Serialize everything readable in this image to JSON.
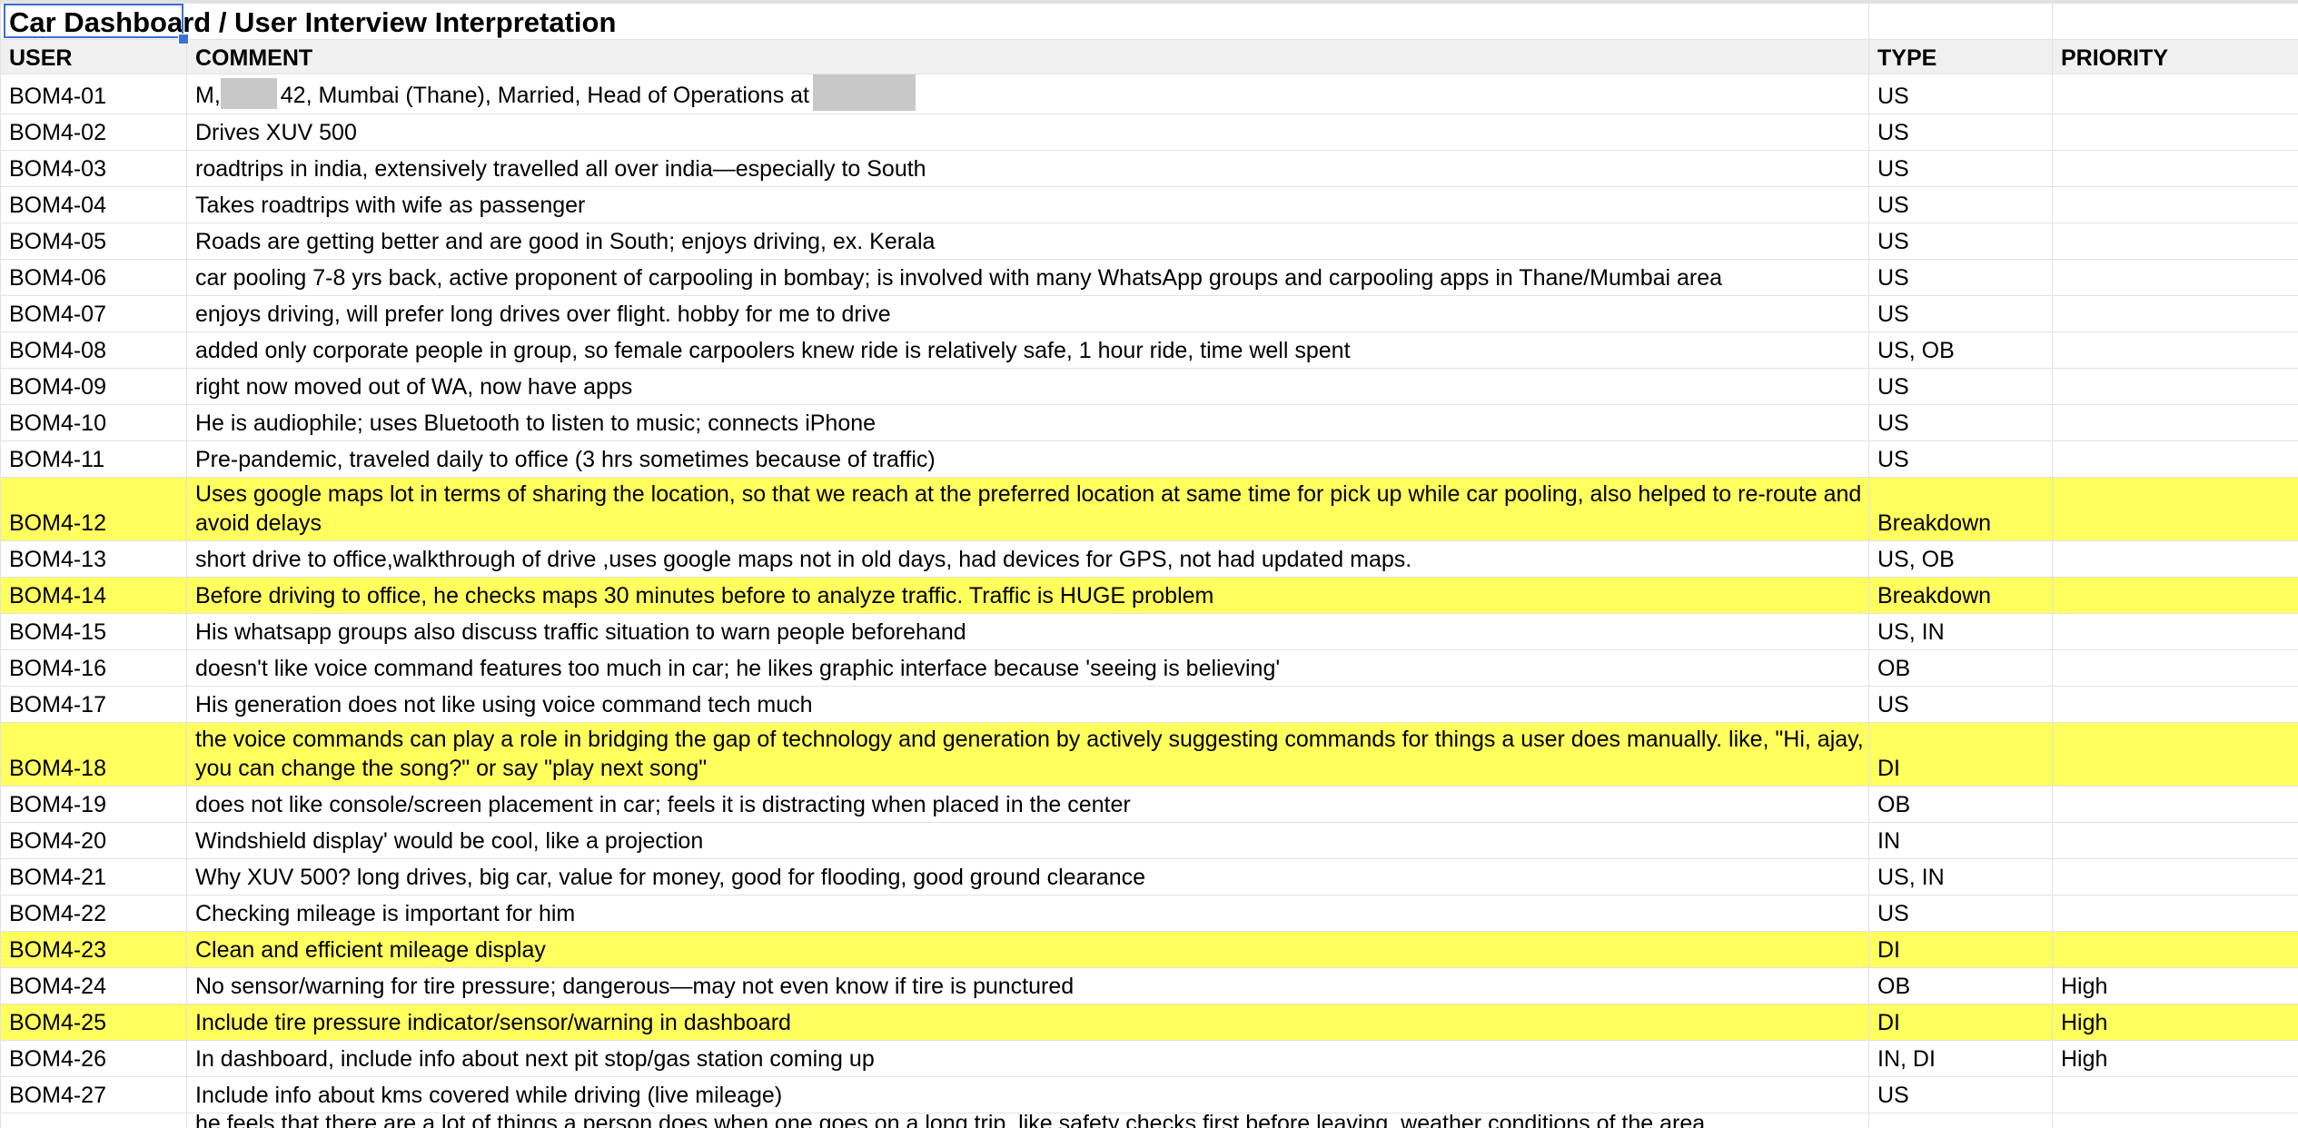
{
  "sheet": {
    "title": "Car Dashboard / User Interview Interpretation",
    "headers": {
      "user": "USER",
      "comment": "COMMENT",
      "type": "TYPE",
      "priority": "PRIORITY"
    },
    "rows": [
      {
        "user": "BOM4-01",
        "comment_pre": "M,",
        "comment_mid": "42, Mumbai (Thane), Married, Head of Operations at",
        "type": "US",
        "priority": ""
      },
      {
        "user": "BOM4-02",
        "comment": "Drives XUV 500",
        "type": "US",
        "priority": ""
      },
      {
        "user": "BOM4-03",
        "comment": "roadtrips in india, extensively travelled all over india—especially to South",
        "type": "US",
        "priority": ""
      },
      {
        "user": "BOM4-04",
        "comment": "Takes roadtrips with wife as passenger",
        "type": "US",
        "priority": ""
      },
      {
        "user": "BOM4-05",
        "comment": "Roads are getting better and are good in South; enjoys driving, ex. Kerala",
        "type": "US",
        "priority": ""
      },
      {
        "user": "BOM4-06",
        "comment": "car pooling 7-8 yrs back, active proponent of carpooling in bombay; is involved with many WhatsApp groups and carpooling apps in Thane/Mumbai area",
        "type": "US",
        "priority": ""
      },
      {
        "user": "BOM4-07",
        "comment": "enjoys driving, will prefer long drives over flight. hobby for me to drive",
        "type": "US",
        "priority": ""
      },
      {
        "user": "BOM4-08",
        "comment": "added only corporate people in group, so female carpoolers knew ride is relatively safe, 1 hour ride, time well spent",
        "type": "US, OB",
        "priority": ""
      },
      {
        "user": "BOM4-09",
        "comment": "right now moved out of WA, now have apps",
        "type": "US",
        "priority": ""
      },
      {
        "user": "BOM4-10",
        "comment": "He is audiophile; uses Bluetooth to listen to music; connects iPhone",
        "type": "US",
        "priority": ""
      },
      {
        "user": "BOM4-11",
        "comment": "Pre-pandemic, traveled daily to office (3 hrs sometimes because of traffic)",
        "type": "US",
        "priority": ""
      },
      {
        "user": "BOM4-12",
        "comment": "Uses google maps lot in terms of sharing the location, so that we reach at the preferred location at same time for pick up while car pooling, also helped to re-route and avoid delays",
        "type": "Breakdown",
        "priority": ""
      },
      {
        "user": "BOM4-13",
        "comment": "short drive to office,walkthrough of drive ,uses google maps not in old days, had devices for GPS, not had updated maps.",
        "type": "US, OB",
        "priority": ""
      },
      {
        "user": "BOM4-14",
        "comment": "Before driving to office, he checks maps 30 minutes before to analyze traffic. Traffic is HUGE problem",
        "type": "Breakdown",
        "priority": ""
      },
      {
        "user": "BOM4-15",
        "comment": "His whatsapp groups also discuss traffic situation to warn people beforehand",
        "type": "US, IN",
        "priority": ""
      },
      {
        "user": "BOM4-16",
        "comment": "doesn't like voice command features too much in car; he likes graphic interface because 'seeing is believing'",
        "type": "OB",
        "priority": ""
      },
      {
        "user": "BOM4-17",
        "comment": "His generation does not like using voice command tech much",
        "type": "US",
        "priority": ""
      },
      {
        "user": "BOM4-18",
        "comment": "the voice commands can play a role in bridging the gap of technology and generation by actively suggesting commands for things a user does manually. like, \"Hi, ajay, you can change the song?\" or say \"play next song\"",
        "type": "DI",
        "priority": ""
      },
      {
        "user": "BOM4-19",
        "comment": "does not like console/screen placement in car; feels it is distracting when placed in the center",
        "type": "OB",
        "priority": ""
      },
      {
        "user": "BOM4-20",
        "comment": "Windshield display' would be cool, like a projection",
        "type": "IN",
        "priority": ""
      },
      {
        "user": "BOM4-21",
        "comment": "Why XUV 500? long drives, big car, value for money, good for flooding, good ground clearance",
        "type": "US, IN",
        "priority": ""
      },
      {
        "user": "BOM4-22",
        "comment": "Checking mileage is important for him",
        "type": "US",
        "priority": ""
      },
      {
        "user": "BOM4-23",
        "comment": "Clean and efficient mileage display",
        "type": "DI",
        "priority": ""
      },
      {
        "user": "BOM4-24",
        "comment": "No sensor/warning for tire pressure; dangerous—may not even know if tire is punctured",
        "type": "OB",
        "priority": "High"
      },
      {
        "user": "BOM4-25",
        "comment": "Include tire pressure indicator/sensor/warning in dashboard",
        "type": "DI",
        "priority": "High"
      },
      {
        "user": "BOM4-26",
        "comment": "In dashboard, include info about next pit stop/gas station coming up",
        "type": "IN, DI",
        "priority": "High"
      },
      {
        "user": "BOM4-27",
        "comment": "Include info about kms covered while driving (live mileage)",
        "type": "US",
        "priority": ""
      },
      {
        "user": "",
        "comment": "he feels that there are a lot of things a person does when one goes on a long trip, like safety checks first before leaving, weather conditions of the area",
        "type": "",
        "priority": ""
      }
    ],
    "highlight_color": "#ffff5e",
    "grid_color": "#e2e2e2",
    "header_bg": "#f0f0f0",
    "selection_color": "#3b6fd6"
  }
}
